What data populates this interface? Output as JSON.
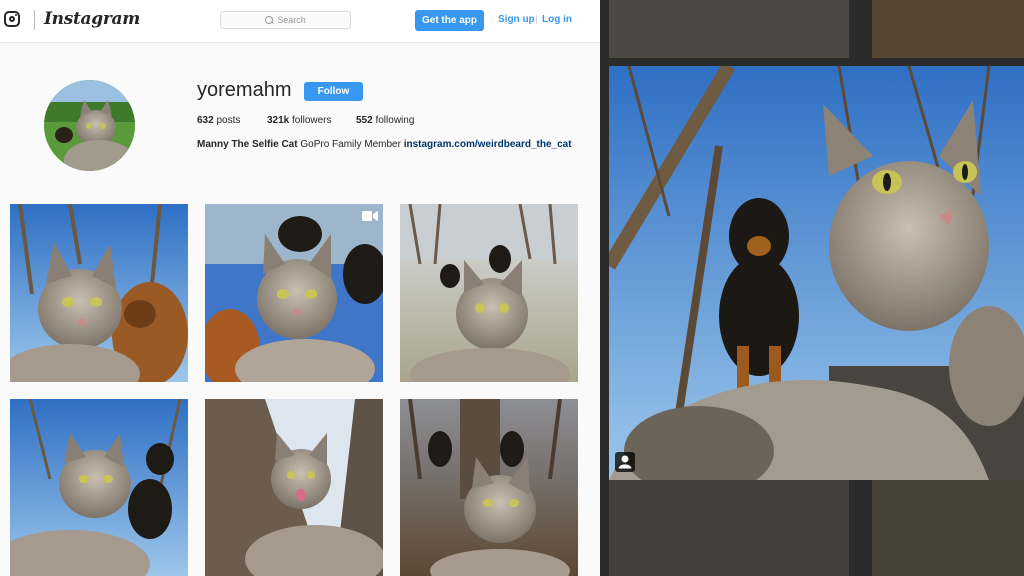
{
  "header": {
    "logo_text": "Instagram",
    "search_placeholder": "Search",
    "get_app_label": "Get the app",
    "signup_label": "Sign up",
    "separator": "|",
    "login_label": "Log in"
  },
  "profile": {
    "username": "yoremahm",
    "follow_label": "Follow",
    "posts_count": "632",
    "posts_label": "posts",
    "followers_count": "321k",
    "followers_label": "followers",
    "following_count": "552",
    "following_label": "following",
    "bio_name": "Manny The Selfie Cat",
    "bio_text": "GoPro Family Member",
    "bio_link": "instagram.com/weirdbeard_the_cat"
  },
  "icons": [
    "instagram-glyph-icon",
    "search-icon",
    "video-badge-icon",
    "user-tag-icon"
  ],
  "colors": {
    "accent": "#3897f0",
    "link": "#003569",
    "overlay": "#2b2b2b"
  }
}
